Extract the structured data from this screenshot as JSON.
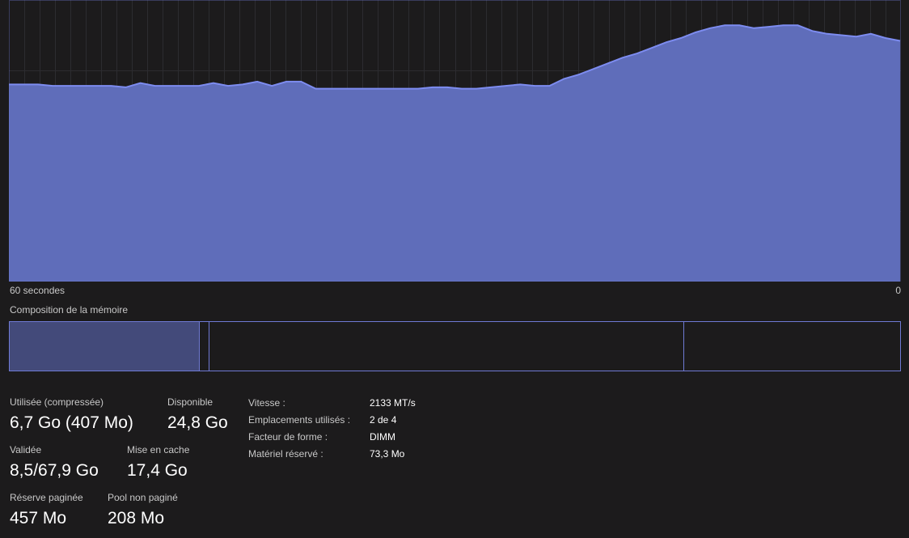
{
  "graph": {
    "x_label_left": "60 secondes",
    "x_label_right": "0",
    "fill_color": "#5f6dba",
    "line_color": "#7d8cf0",
    "grid_color": "#2c2c30",
    "usage_series_pct": [
      70,
      70,
      70,
      69.5,
      69.5,
      69.5,
      69.5,
      69.5,
      69,
      70.5,
      69.5,
      69.5,
      69.5,
      69.5,
      70.5,
      69.5,
      70,
      71,
      69.5,
      71,
      71,
      68.5,
      68.5,
      68.5,
      68.5,
      68.5,
      68.5,
      68.5,
      68.5,
      69,
      69,
      68.5,
      68.5,
      69,
      69.5,
      70,
      69.5,
      69.5,
      72,
      73.5,
      75.5,
      77.5,
      79.5,
      81,
      83,
      85,
      86.5,
      88.5,
      90,
      91,
      91,
      90,
      90.5,
      91,
      91,
      89,
      88,
      87.5,
      87,
      88,
      86.5,
      85.5
    ]
  },
  "composition": {
    "label": "Composition de la mémoire",
    "border_color": "#6f7ad4",
    "used_color": "#434a7a"
  },
  "stats": {
    "used_label": "Utilisée (compressée)",
    "used_value": "6,7 Go (407 Mo)",
    "available_label": "Disponible",
    "available_value": "24,8 Go",
    "committed_label": "Validée",
    "committed_value": "8,5/67,9 Go",
    "cached_label": "Mise en cache",
    "cached_value": "17,4 Go",
    "paged_label": "Réserve paginée",
    "paged_value": "457 Mo",
    "nonpaged_label": "Pool non paginé",
    "nonpaged_value": "208 Mo"
  },
  "properties": [
    {
      "key": "Vitesse :",
      "value": "2133 MT/s"
    },
    {
      "key": "Emplacements utilisés :",
      "value": "2 de 4"
    },
    {
      "key": "Facteur de forme :",
      "value": "DIMM"
    },
    {
      "key": "Matériel réservé :",
      "value": "73,3 Mo"
    }
  ]
}
